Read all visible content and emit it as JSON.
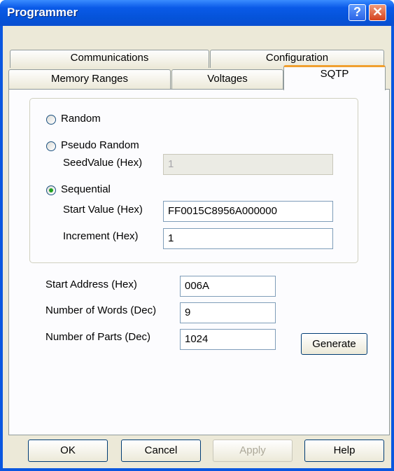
{
  "window": {
    "title": "Programmer",
    "help_glyph": "?",
    "close_glyph": "✕"
  },
  "tabs": {
    "row1": [
      "Communications",
      "Configuration"
    ],
    "row2": [
      "Memory Ranges",
      "Voltages",
      "SQTP"
    ],
    "active": "SQTP"
  },
  "sqtp": {
    "radio_random": "Random",
    "radio_pseudo": "Pseudo Random",
    "seed_label": "SeedValue (Hex)",
    "seed_value": "1",
    "radio_sequential": "Sequential",
    "selected_mode": "Sequential",
    "start_value_label": "Start Value (Hex)",
    "start_value": "FF0015C8956A000000",
    "increment_label": "Increment (Hex)",
    "increment_value": "1",
    "start_address_label": "Start Address (Hex)",
    "start_address_value": "006A",
    "num_words_label": "Number of Words (Dec)",
    "num_words_value": "9",
    "num_parts_label": "Number of Parts (Dec)",
    "num_parts_value": "1024",
    "generate_label": "Generate"
  },
  "buttons": {
    "ok": "OK",
    "cancel": "Cancel",
    "apply": "Apply",
    "help": "Help"
  },
  "colors": {
    "titlebar": "#0a5ae8",
    "dialog_bg": "#ece9d8",
    "active_tab_accent": "#f0a030",
    "radio_checked": "#21a121"
  }
}
